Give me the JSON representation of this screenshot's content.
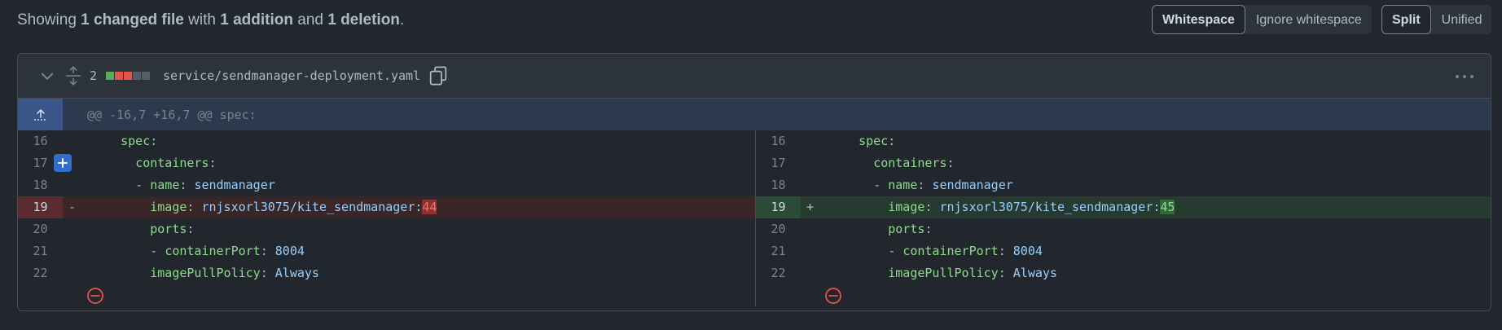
{
  "summary": {
    "prefix": "Showing ",
    "files": "1 changed file",
    "with": " with ",
    "additions": "1 addition",
    "and": " and ",
    "deletions": "1 deletion",
    "suffix": "."
  },
  "whitespace_toggle": {
    "whitespace": "Whitespace",
    "ignore": "Ignore whitespace",
    "selected": "Whitespace"
  },
  "view_toggle": {
    "split": "Split",
    "unified": "Unified",
    "selected": "Split"
  },
  "file": {
    "change_count": "2",
    "diffstat": [
      "#57ab5a",
      "#e5534b",
      "#e5534b",
      "#545d68",
      "#545d68"
    ],
    "path": "service/sendmanager-deployment.yaml",
    "hunk_header": "@@ -16,7 +16,7 @@ spec:"
  },
  "left": {
    "lines": [
      {
        "n": "16",
        "sign": "",
        "type": "ctx"
      },
      {
        "n": "17",
        "sign": "",
        "type": "ctx"
      },
      {
        "n": "18",
        "sign": "",
        "type": "ctx"
      },
      {
        "n": "19",
        "sign": "-",
        "type": "del"
      },
      {
        "n": "20",
        "sign": "",
        "type": "ctx"
      },
      {
        "n": "21",
        "sign": "",
        "type": "ctx"
      },
      {
        "n": "22",
        "sign": "",
        "type": "ctx"
      }
    ]
  },
  "right": {
    "lines": [
      {
        "n": "16",
        "sign": "",
        "type": "ctx"
      },
      {
        "n": "17",
        "sign": "",
        "type": "ctx"
      },
      {
        "n": "18",
        "sign": "",
        "type": "ctx"
      },
      {
        "n": "19",
        "sign": "+",
        "type": "add"
      },
      {
        "n": "20",
        "sign": "",
        "type": "ctx"
      },
      {
        "n": "21",
        "sign": "",
        "type": "ctx"
      },
      {
        "n": "22",
        "sign": "",
        "type": "ctx"
      }
    ]
  },
  "code": {
    "spec": "spec",
    "containers": "containers",
    "name_key": "name",
    "name_val": "sendmanager",
    "image_key": "image",
    "image_val": "rnjsxorl3075/kite_sendmanager:",
    "image_old_tag": "44",
    "image_new_tag": "45",
    "ports": "ports",
    "cport_key": "containerPort",
    "cport_val": "8004",
    "pull_key": "imagePullPolicy",
    "pull_val": "Always"
  },
  "colors": {
    "addition": "#57ab5a",
    "deletion": "#e5534b",
    "accent": "#316dca"
  }
}
